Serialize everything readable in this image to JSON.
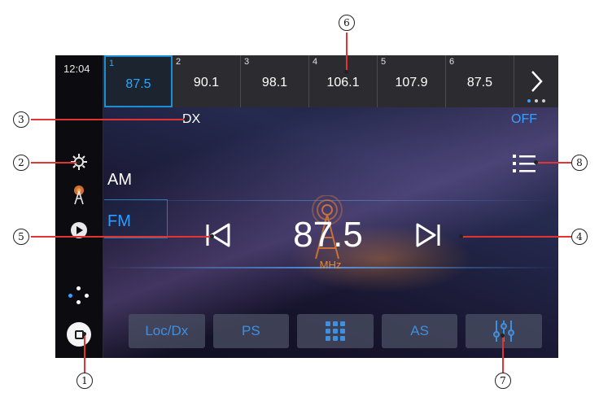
{
  "clock": "12:04",
  "presets": [
    {
      "num": "1",
      "freq": "87.5",
      "active": true
    },
    {
      "num": "2",
      "freq": "90.1",
      "active": false
    },
    {
      "num": "3",
      "freq": "98.1",
      "active": false
    },
    {
      "num": "4",
      "freq": "106.1",
      "active": false
    },
    {
      "num": "5",
      "freq": "107.9",
      "active": false
    },
    {
      "num": "6",
      "freq": "87.5",
      "active": false
    }
  ],
  "status": {
    "dx_label": "DX",
    "off_label": "OFF"
  },
  "bands": {
    "am": "AM",
    "fm": "FM",
    "selected": "FM"
  },
  "tuner": {
    "frequency": "87.5",
    "unit": "MHz"
  },
  "function_buttons": [
    {
      "label": "Loc/Dx",
      "icon": null
    },
    {
      "label": "PS",
      "icon": null
    },
    {
      "label": "",
      "icon": "keypad-icon"
    },
    {
      "label": "AS",
      "icon": null
    },
    {
      "label": "",
      "icon": "equalizer-icon"
    }
  ],
  "sidebar_icons": [
    "settings-icon",
    "radio-tower-icon",
    "play-icon"
  ],
  "callouts": [
    "1",
    "2",
    "3",
    "4",
    "5",
    "6",
    "7",
    "8"
  ],
  "colors": {
    "accent": "#28a7ff",
    "callout_line": "#e53333",
    "unit": "#e08a3c"
  }
}
